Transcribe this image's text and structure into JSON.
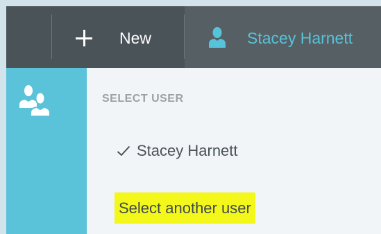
{
  "colors": {
    "topbar": "#4a5358",
    "active_tab": "#565f64",
    "accent": "#57c3da",
    "rail": "#5ac3d9",
    "panel": "#f2f5f8",
    "highlight": "#f3f71a"
  },
  "toolbar": {
    "new_icon": "plus-icon",
    "new_label": "New",
    "user_icon": "user-icon",
    "user_label": "Stacey Harnett"
  },
  "sidebar": {
    "icon": "users-icon"
  },
  "panel": {
    "heading": "SELECT USER",
    "current_user": {
      "icon": "check-icon",
      "label": "Stacey Harnett",
      "selected": true
    },
    "select_another_label": "Select another user"
  }
}
